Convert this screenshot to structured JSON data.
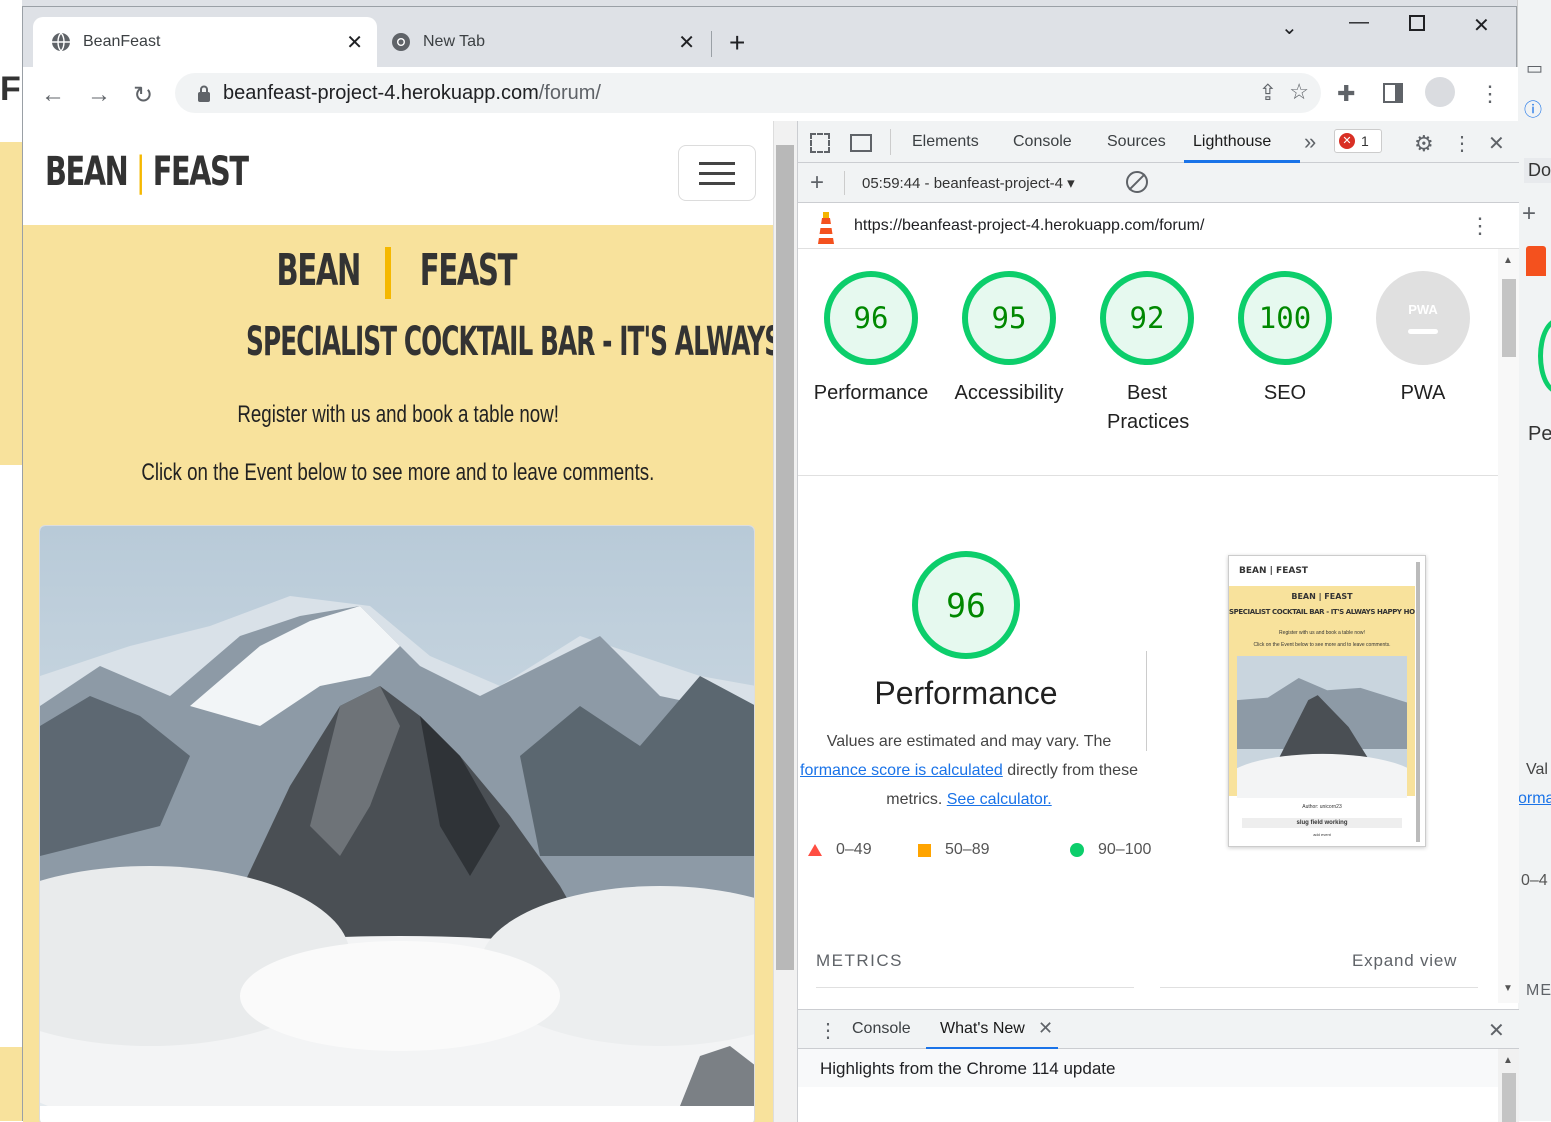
{
  "browser": {
    "tabs": [
      {
        "title": "BeanFeast",
        "icon": "globe-icon",
        "active": true
      },
      {
        "title": "New Tab",
        "icon": "chrome-icon",
        "active": false
      }
    ],
    "address": {
      "host": "beanfeast-project-4.herokuapp.com",
      "path": "/forum/"
    }
  },
  "site": {
    "logo_left": "BEAN",
    "logo_right": "FEAST",
    "tagline": "SPECIALIST COCKTAIL BAR - IT'S ALWAYS HAPPY HOUR!",
    "intro1": "Register with us and book a table now!",
    "intro2": "Click on the Event below to see more and to leave comments.",
    "colors": {
      "hero_bg": "#f8e29c",
      "accent": "#f5b800"
    }
  },
  "devtools": {
    "tabs": [
      "Elements",
      "Console",
      "Sources",
      "Lighthouse"
    ],
    "active_tab": "Lighthouse",
    "more": "»",
    "error_count": "1",
    "report_select": "05:59:44 - beanfeast-project-4",
    "report_url": "https://beanfeast-project-4.herokuapp.com/forum/",
    "scores": [
      {
        "label": "Performance",
        "score": "96"
      },
      {
        "label": "Accessibility",
        "score": "95"
      },
      {
        "label": "Best Practices",
        "score": "92"
      },
      {
        "label": "SEO",
        "score": "100"
      },
      {
        "label": "PWA",
        "score": ""
      }
    ],
    "pwa_badge": "PWA",
    "performance": {
      "score": "96",
      "title": "Performance",
      "desc_1": "Values are estimated and may vary. The",
      "desc_link": "formance score is calculated",
      "desc_2": "directly from these",
      "desc_3": "metrics.",
      "calc_link": "See calculator."
    },
    "legend": [
      {
        "range": "0–49",
        "color": "#ff4e42"
      },
      {
        "range": "50–89",
        "color": "#ffa400"
      },
      {
        "range": "90–100",
        "color": "#0cce6b"
      }
    ],
    "thumbnail": {
      "logo": "BEAN | FEAST",
      "logo2": "BEAN | FEAST",
      "tagline": "SPECIALIST COCKTAIL BAR - IT'S ALWAYS HAPPY HOUR!",
      "line1": "Register with us and book a table now!",
      "line2": "Click on the Event below to see more and to leave comments.",
      "author": "Author: unicorn23",
      "event": "slug field working",
      "sub": "add event"
    },
    "metrics_label": "METRICS",
    "expand_view": "Expand view",
    "drawer": {
      "tabs": [
        "Console",
        "What's New"
      ],
      "heading": "Highlights from the Chrome 114 update"
    }
  },
  "background_window": {
    "left_fragment": "FI",
    "right_fragments": [
      "Dor",
      "Pe",
      "Val",
      "orma",
      "0–4",
      "ME"
    ]
  }
}
